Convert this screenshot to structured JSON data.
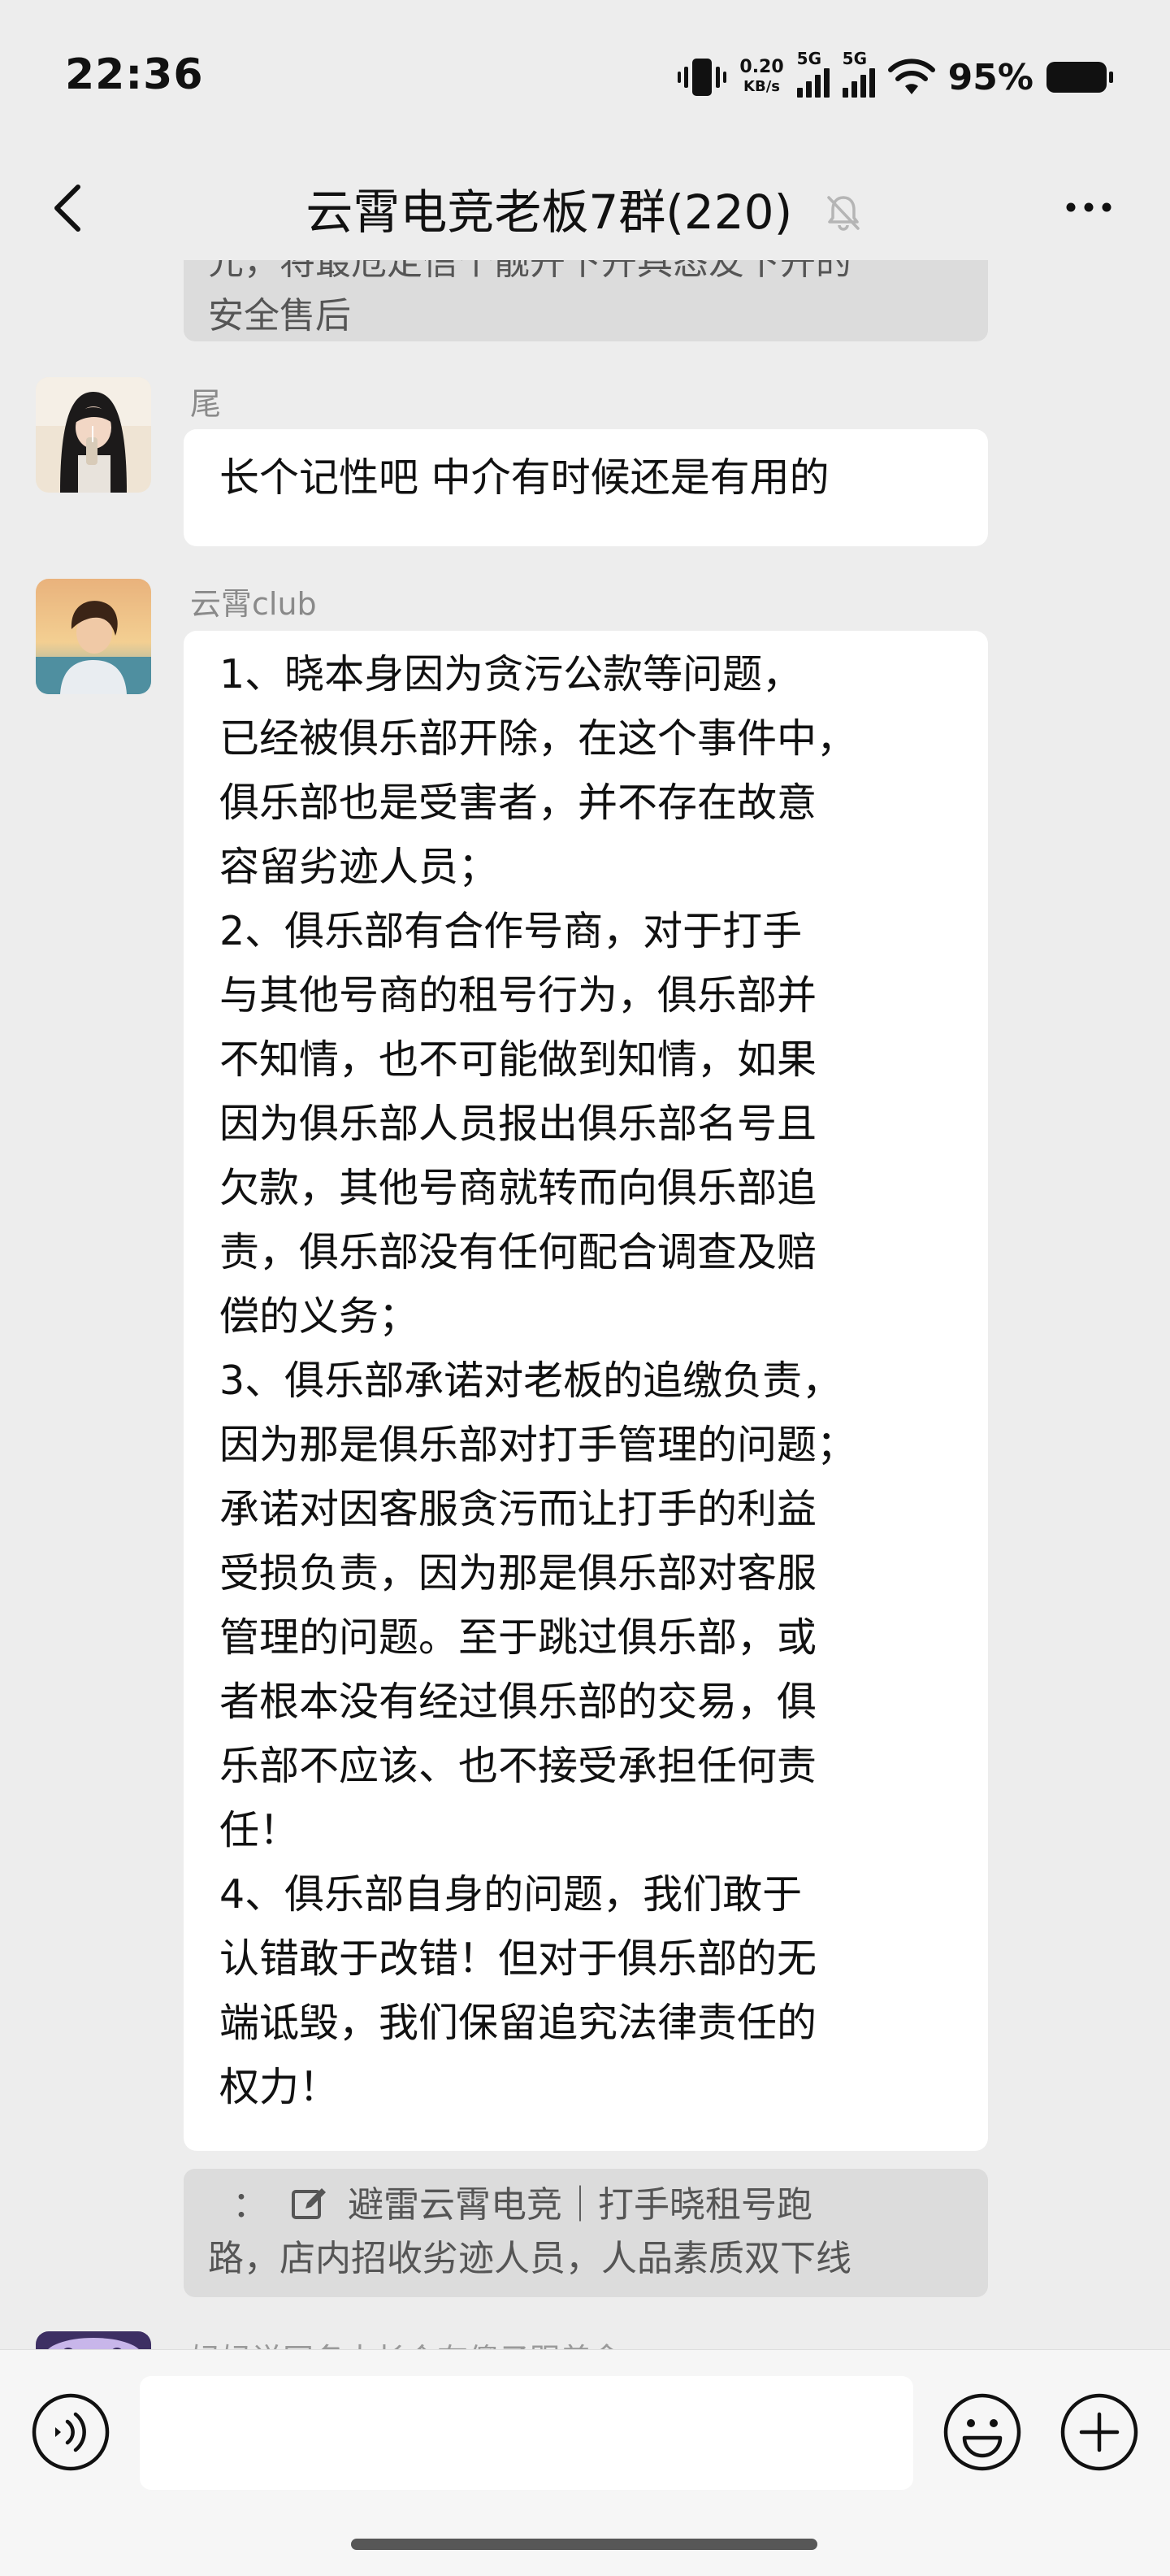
{
  "status_bar": {
    "time": "22:36",
    "net_speed_value": "0.20",
    "net_speed_unit": "KB/s",
    "sim1": "5G",
    "sim2": "5G",
    "battery_pct": "95%"
  },
  "header": {
    "title": "云霄电竞老板7群(220)",
    "icons": {
      "back": "chevron-left-icon",
      "mute": "bell-off-icon",
      "more": "more-dots-icon"
    }
  },
  "messages": {
    "prev_quote_partial": "元，将最危定信个靓开下开具态友下开的",
    "prev_quote_last": "安全售后",
    "msg1": {
      "sender": "尾",
      "text": "长个记性吧 中介有时候还是有用的"
    },
    "msg2": {
      "sender": "云霄club",
      "lines": [
        "1、晓本身因为贪污公款等问题，",
        "已经被俱乐部开除，在这个事件中，",
        "俱乐部也是受害者，并不存在故意",
        "容留劣迹人员；",
        "2、俱乐部有合作号商，对于打手",
        "与其他号商的租号行为，俱乐部并",
        "不知情，也不可能做到知情，如果",
        "因为俱乐部人员报出俱乐部名号且",
        "欠款，其他号商就转而向俱乐部追",
        "责，俱乐部没有任何配合调查及赔",
        "偿的义务；",
        "3、俱乐部承诺对老板的追缴负责，",
        "因为那是俱乐部对打手管理的问题；",
        "承诺对因客服贪污而让打手的利益",
        "受损负责，因为那是俱乐部对客服",
        "管理的问题。至于跳过俱乐部，或",
        "者根本没有经过俱乐部的交易，俱",
        "乐部不应该、也不接受承担任何责",
        "任！",
        "4、俱乐部自身的问题，我们敢于",
        "认错敢于改错！但对于俱乐部的无",
        "端诋毁，我们保留追究法律责任的",
        "权力！"
      ],
      "quote_prefix": "：",
      "quote_line1": "避雷云霄电竞｜打手晓租号跑",
      "quote_line2": "路，店内招收劣迹人员，人品素质双下线"
    },
    "msg3": {
      "partial_text": "妈妈说网名太长会有傻子跟着念"
    }
  },
  "input_bar": {
    "text_value": "",
    "icons": {
      "voice": "voice-icon",
      "emoji": "emoji-icon",
      "plus": "plus-icon"
    }
  }
}
